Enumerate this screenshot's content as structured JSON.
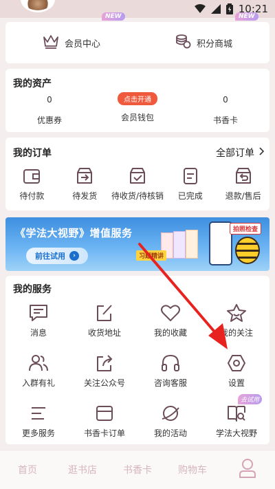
{
  "status_bar": {
    "time": "10:21"
  },
  "top": {
    "items": [
      {
        "label": "会员中心",
        "badge": "NEW"
      },
      {
        "label": "积分商城",
        "badge": "NEW"
      }
    ]
  },
  "assets": {
    "title": "我的资产",
    "items": [
      {
        "value": "0",
        "label": "优惠券"
      },
      {
        "action": "点击开通",
        "label": "会员钱包"
      },
      {
        "value": "0",
        "label": "书香卡"
      }
    ]
  },
  "orders": {
    "title": "我的订单",
    "all_label": "全部订单",
    "items": [
      {
        "label": "待付款",
        "icon": "wallet-icon"
      },
      {
        "label": "待发货",
        "icon": "box-arrow-icon"
      },
      {
        "label": "待收货/待核销",
        "icon": "box-check-icon"
      },
      {
        "label": "已完成",
        "icon": "document-icon"
      },
      {
        "label": "退款/售后",
        "icon": "return-icon"
      }
    ]
  },
  "banner": {
    "title": "《学法大视野》增值服务",
    "button": "前往试用",
    "tag1": "习题精讲",
    "tag2": "拍照检查"
  },
  "services": {
    "title": "我的服务",
    "rows": [
      [
        {
          "label": "消息",
          "icon": "message-icon"
        },
        {
          "label": "收货地址",
          "icon": "edit-icon"
        },
        {
          "label": "我的收藏",
          "icon": "heart-icon"
        },
        {
          "label": "我的关注",
          "icon": "star-icon"
        }
      ],
      [
        {
          "label": "入群有礼",
          "icon": "group-icon"
        },
        {
          "label": "关注公众号",
          "icon": "share-icon"
        },
        {
          "label": "咨询客服",
          "icon": "headphones-icon"
        },
        {
          "label": "设置",
          "icon": "settings-icon"
        }
      ],
      [
        {
          "label": "更多服务",
          "icon": "menu-icon"
        },
        {
          "label": "书香卡订单",
          "icon": "card-icon"
        },
        {
          "label": "我的活动",
          "icon": "planet-icon"
        },
        {
          "label": "学法大视野",
          "icon": "book-search-icon",
          "badge": "去试用"
        }
      ]
    ]
  },
  "tabbar": {
    "items": [
      "首页",
      "逛书店",
      "书香卡",
      "购物车"
    ],
    "profile_icon": "person-icon"
  },
  "colors": {
    "icon_stroke": "#6b4d5a",
    "accent": "#f05a3c",
    "annotation_arrow": "#e8231f"
  }
}
